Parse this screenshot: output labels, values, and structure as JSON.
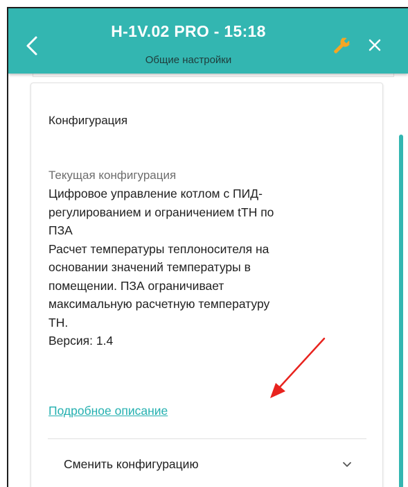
{
  "header": {
    "title": "H-1V.02 PRO - 15:18",
    "subtitle": "Общие настройки"
  },
  "card": {
    "title": "Конфигурация",
    "current_label": "Текущая конфигурация",
    "lines": [
      "Цифровое управление котлом с ПИД-",
      "регулированием и ограничением tTH по",
      "ПЗА",
      "Расчет температуры теплоносителя на",
      "основании значений температуры в",
      "помещении. ПЗА ограничивает",
      "максимальную расчетную температуру",
      "ТН.",
      "Версия: 1.4"
    ],
    "more_link": "Подробное описание",
    "change_label": "Сменить конфигурацию"
  },
  "colors": {
    "header": "#33b6b1",
    "link": "#24b0b0",
    "wrench": "#f5a623",
    "annotation_arrow": "#e8231e"
  },
  "icons": [
    "back-arrow-icon",
    "wrench-icon",
    "close-icon",
    "chevron-down-icon",
    "annotation-arrow-icon"
  ]
}
